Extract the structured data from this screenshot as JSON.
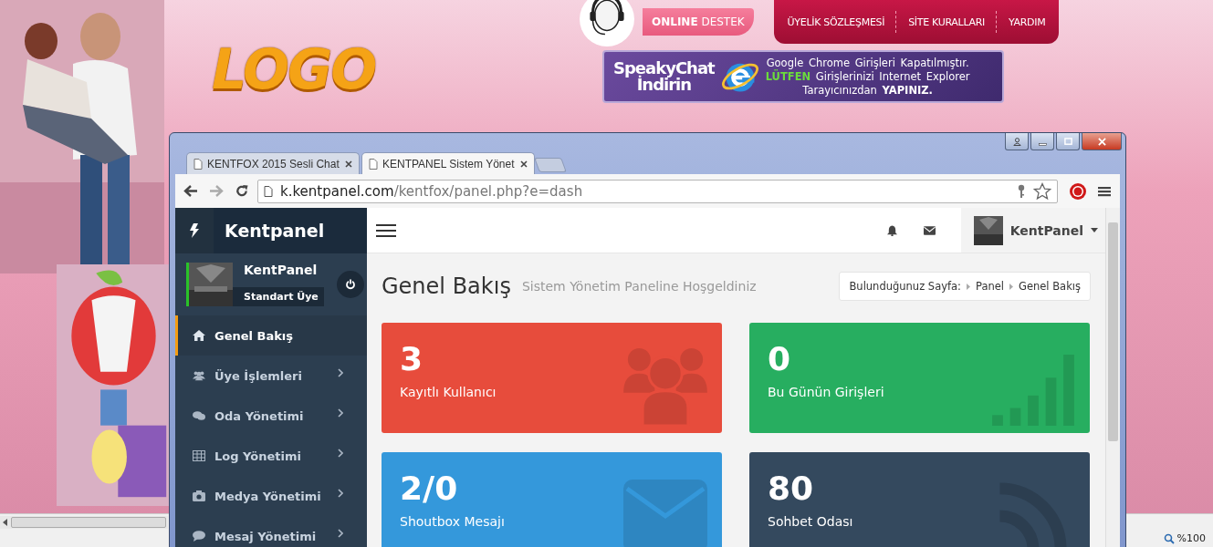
{
  "site": {
    "logo": "LOGO",
    "support": {
      "strong": "ONLINE",
      "label": "DESTEK"
    },
    "nav": [
      {
        "label": "ÜYELİK SÖZLEŞMESİ"
      },
      {
        "label": "SİTE KURALLARI"
      },
      {
        "label": "YARDIM"
      }
    ],
    "banner": {
      "title": "SpeakyChat",
      "subtitle": "İndirin",
      "lines": [
        "Google Chrome Girişleri Kapatılmıştır.",
        "**LÜTFEN** Girişlerinizi Internet Explorer",
        "Tarayıcınızdan **YAPINIZ.**"
      ]
    }
  },
  "browser": {
    "tabs": [
      {
        "title": "KENTFOX 2015 Sesli Chat",
        "selected": false
      },
      {
        "title": "KENTPANEL Sistem Yönet",
        "selected": true
      }
    ],
    "url": {
      "host": "k.kentpanel.com",
      "path": "/kentfox/panel.php?e=dash"
    }
  },
  "panel": {
    "brand": "Kentpanel",
    "user": {
      "name": "KentPanel",
      "role": "Standart Üye"
    },
    "menu": [
      {
        "label": "Genel Bakış",
        "kind": "home",
        "selected": true,
        "has_children": false
      },
      {
        "label": "Üye İşlemleri",
        "kind": "users",
        "selected": false,
        "has_children": true
      },
      {
        "label": "Oda Yönetimi",
        "kind": "chat",
        "selected": false,
        "has_children": true
      },
      {
        "label": "Log Yönetimi",
        "kind": "table",
        "selected": false,
        "has_children": true
      },
      {
        "label": "Medya Yönetimi",
        "kind": "camera",
        "selected": false,
        "has_children": true
      },
      {
        "label": "Mesaj Yönetimi",
        "kind": "comment",
        "selected": false,
        "has_children": true
      }
    ],
    "account": "KentPanel",
    "title": "Genel Bakış",
    "subtitle": "Sistem Yönetim Paneline Hoşgeldiniz",
    "breadcrumb": {
      "label": "Bulunduğunuz Sayfa:",
      "items": [
        "Panel",
        "Genel Bakış"
      ]
    },
    "stats": [
      {
        "value": "3",
        "label": "Kayıtlı Kullanıcı",
        "color": "#e74c3c",
        "kind": "users"
      },
      {
        "value": "0",
        "label": "Bu Günün Girişleri",
        "color": "#27ae60",
        "kind": "bars"
      },
      {
        "value": "2/0",
        "label": "Shoutbox Mesajı",
        "color": "#3498db",
        "kind": "envelope"
      },
      {
        "value": "80",
        "label": "Sohbet Odası",
        "color": "#34495e",
        "kind": "rss"
      }
    ]
  },
  "status_bar": {
    "zoom": "%100"
  }
}
